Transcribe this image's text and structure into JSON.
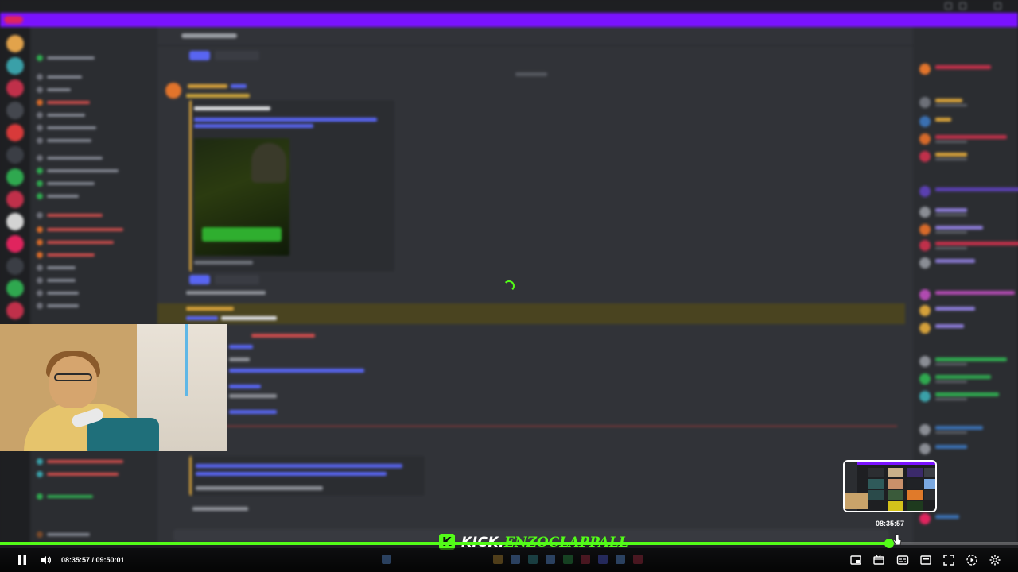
{
  "player": {
    "current_time": "08:35:57",
    "duration": "09:50:01",
    "time_display": "08:35:57 / 09:50:01",
    "progress_fraction": 0.8735,
    "hover_time": "08:35:57",
    "accent_color": "#53fc18"
  },
  "watermark": {
    "brand": "KICK.",
    "username": "ENZOCLAPPALL"
  },
  "controls": {
    "left": [
      "pause-icon",
      "volume-icon"
    ],
    "right": [
      "pip-icon",
      "theater-icon",
      "captions-icon",
      "clip-icon",
      "fullscreen-icon",
      "speed-icon",
      "settings-icon"
    ]
  },
  "background": {
    "app": "Discord",
    "promo_color": "#7a12ff",
    "highlight_color": "#4a4420"
  },
  "colors": {
    "kick_green": "#53fc18",
    "discord_bg": "#313338",
    "sidebar_bg": "#2b2d31"
  }
}
